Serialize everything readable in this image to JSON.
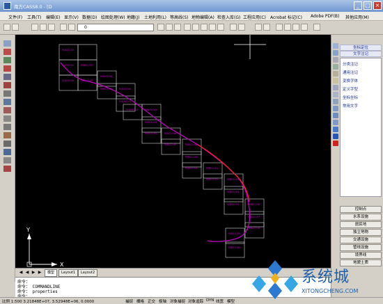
{
  "window": {
    "title": "南方CASS8.0 - [D",
    "minimize": "_",
    "maximize": "□",
    "close": "×"
  },
  "menu": {
    "items": [
      "文件(F)",
      "工具(T)",
      "编辑(E)",
      "显示(V)",
      "数据(D)",
      "绘图处理(W)",
      "地籍(J)",
      "土地利用(L)",
      "等高线(S)",
      "地物编辑(A)",
      "检查入库(G)",
      "工程应用(C)",
      "Acrobat 标记(C)",
      "Adobe PDF(B)",
      "其他应用(M)"
    ]
  },
  "toolbar": {
    "layer_value": "0"
  },
  "drawing": {
    "sheets": [
      {
        "label": "76802033"
      },
      {
        "label": ""
      },
      {
        "label": "76802034"
      },
      {
        "label": "76802035"
      },
      {
        "label": "76802036"
      },
      {
        "label": "76802037"
      },
      {
        "label": "76802038"
      },
      {
        "label": "76802039"
      },
      {
        "label": "76802040"
      },
      {
        "label": "76802041"
      },
      {
        "label": "76802042"
      },
      {
        "label": "76802043"
      },
      {
        "label": "76802044"
      },
      {
        "label": "76802045"
      },
      {
        "label": "76802046"
      },
      {
        "label": "76802047"
      },
      {
        "label": "76802048"
      },
      {
        "label": "76802049"
      },
      {
        "label": "76802050"
      },
      {
        "label": "76802051"
      },
      {
        "label": "76802052"
      },
      {
        "label": "76802053"
      },
      {
        "label": "76802054"
      },
      {
        "label": "76802055"
      },
      {
        "label": "76802056"
      },
      {
        "label": "76802057"
      },
      {
        "label": "76802058"
      },
      {
        "label": "76802059"
      },
      {
        "label": "76802060"
      },
      {
        "label": "76802061"
      },
      {
        "label": "76802062"
      },
      {
        "label": "76802063"
      },
      {
        "label": "76802064"
      },
      {
        "label": "76802065"
      },
      {
        "label": "76802066"
      },
      {
        "label": "76802067"
      },
      {
        "label": "76802068"
      },
      {
        "label": "76802069"
      },
      {
        "label": "76802070"
      },
      {
        "label": "76802071"
      },
      {
        "label": "76802072"
      },
      {
        "label": "76802073"
      }
    ],
    "ucs_x": "X",
    "ucs_y": "Y",
    "line_color": "#c000c0",
    "highlight_color": "#ff2020",
    "grid_color": "#d8d8d8"
  },
  "layout_tabs": [
    "模型",
    "Layout1",
    "Layout2"
  ],
  "command": {
    "lines": [
      "命令：",
      "命令： COMMANDLINE",
      "命令： properties",
      "命令："
    ]
  },
  "status": {
    "coords": "比例 1:500   3.21848E+07, 3.52948E+06, 0.0000",
    "toggles": [
      "捕捉",
      "栅格",
      "正交",
      "极轴",
      "对象捕捉",
      "对象追踪",
      "DYN",
      "线宽",
      "模型"
    ]
  },
  "right_panel": {
    "header1": "坐标定位",
    "header2": "文字注记",
    "items": [
      "分类注记",
      "通用注记",
      "变换字体",
      "定义字型",
      "坐标坐标",
      "常用文字"
    ],
    "buttons": [
      "控制点",
      "水系设施",
      "居民地",
      "独立地物",
      "交通设施",
      "管线设施",
      "境界线",
      "地貌土质"
    ],
    "icon_colors": [
      "#9bb3d6",
      "#8aa2c8",
      "#a7a9b4",
      "#98b0a0",
      "#b6b098",
      "#c9c2a0",
      "#a0a8c0",
      "#a9b6c9",
      "#90a4c0",
      "#7d99c4",
      "#6f8fc0",
      "#7d99c4",
      "#4a79c9",
      "#2a55b8",
      "#d02020"
    ]
  },
  "watermark": {
    "text": "系统城",
    "sub": "XITONGCHENG.COM"
  }
}
